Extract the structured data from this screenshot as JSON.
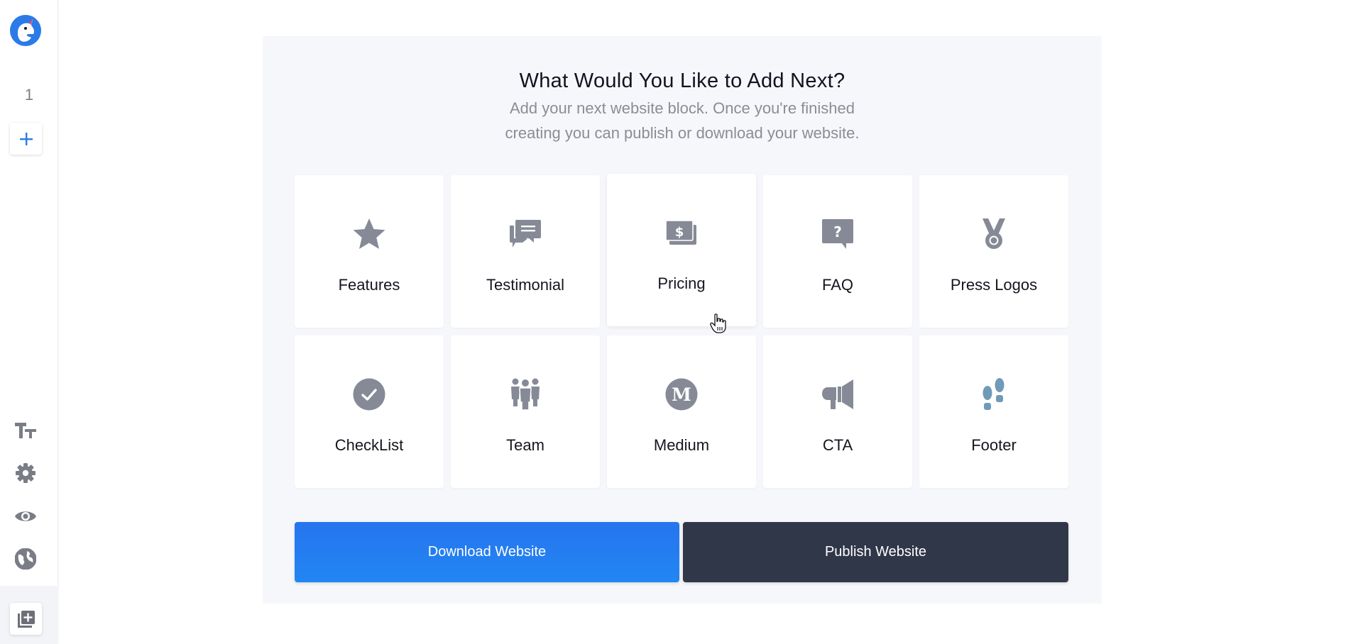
{
  "sidebar": {
    "logo": "unicorn-logo",
    "page_number": "1",
    "add_page_icon": "plus-icon",
    "tools": [
      {
        "name": "typography",
        "icon": "text-size-icon"
      },
      {
        "name": "settings",
        "icon": "gear-icon"
      },
      {
        "name": "preview",
        "icon": "eye-icon"
      },
      {
        "name": "publish",
        "icon": "globe-icon"
      }
    ],
    "bottom_action_icon": "add-copy-icon"
  },
  "panel": {
    "title": "What Would You Like to Add Next?",
    "subtitle_line1": "Add your next website block. Once you're finished",
    "subtitle_line2": "creating you can publish or download your website."
  },
  "blocks": [
    {
      "label": "Features",
      "icon": "star-icon"
    },
    {
      "label": "Testimonial",
      "icon": "chat-bubbles-icon"
    },
    {
      "label": "Pricing",
      "icon": "money-icon"
    },
    {
      "label": "FAQ",
      "icon": "question-bubble-icon"
    },
    {
      "label": "Press Logos",
      "icon": "medal-icon"
    },
    {
      "label": "CheckList",
      "icon": "check-circle-icon"
    },
    {
      "label": "Team",
      "icon": "team-icon"
    },
    {
      "label": "Medium",
      "icon": "medium-icon"
    },
    {
      "label": "CTA",
      "icon": "megaphone-icon"
    },
    {
      "label": "Footer",
      "icon": "footprints-icon"
    }
  ],
  "actions": {
    "download_label": "Download Website",
    "publish_label": "Publish Website"
  },
  "colors": {
    "accent_blue": "#2680F0",
    "dark_button": "#303749",
    "icon_gray": "#868a96",
    "footer_icon": "#6f9bb8",
    "panel_bg": "#f6f7fb"
  }
}
